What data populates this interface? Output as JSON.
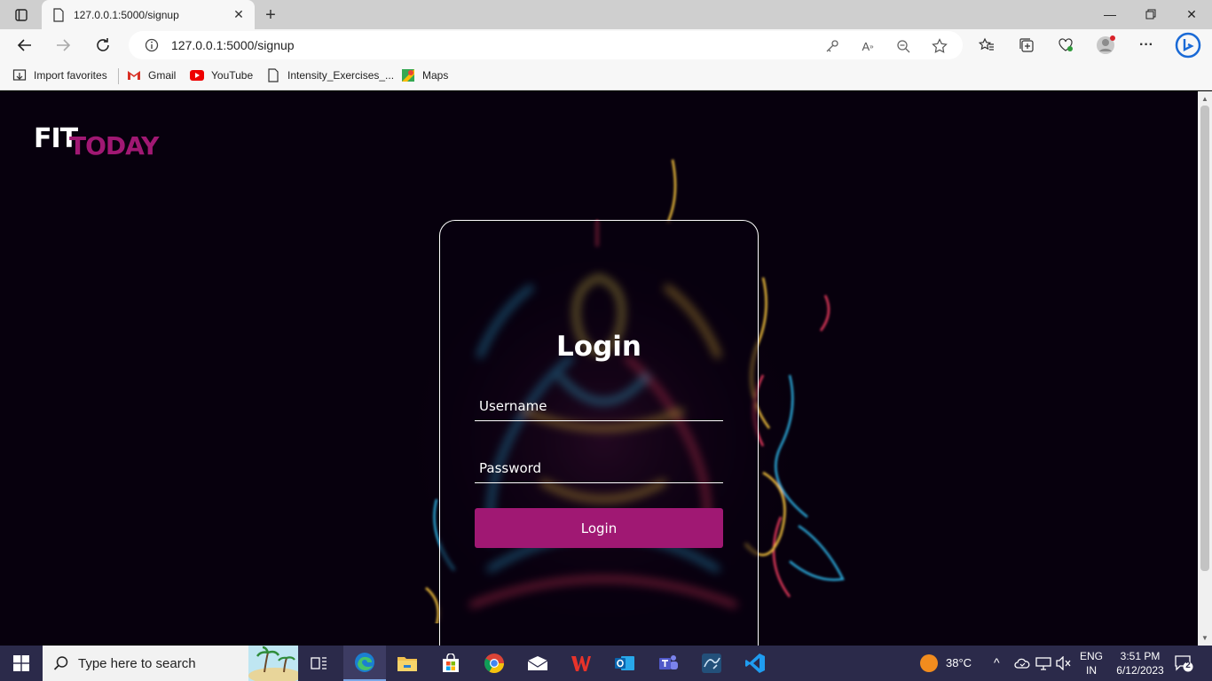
{
  "browser": {
    "tab_title": "127.0.0.1:5000/signup",
    "url": "127.0.0.1:5000/signup",
    "bookmarks": [
      {
        "label": "Import favorites",
        "icon": "import-icon"
      },
      {
        "label": "Gmail",
        "icon": "gmail-icon"
      },
      {
        "label": "YouTube",
        "icon": "youtube-icon"
      },
      {
        "label": "Intensity_Exercises_...",
        "icon": "document-icon"
      },
      {
        "label": "Maps",
        "icon": "maps-icon"
      }
    ]
  },
  "page": {
    "logo_fit": "FIT",
    "logo_today": "TODAY",
    "login_title": "Login",
    "username_placeholder": "Username",
    "password_placeholder": "Password",
    "login_button": "Login",
    "colors": {
      "accent": "#a01873",
      "background": "#07000d"
    }
  },
  "taskbar": {
    "search_placeholder": "Type here to search",
    "weather": "38°C",
    "language_1": "ENG",
    "language_2": "IN",
    "time": "3:51 PM",
    "date": "6/12/2023",
    "notifications": "2"
  }
}
